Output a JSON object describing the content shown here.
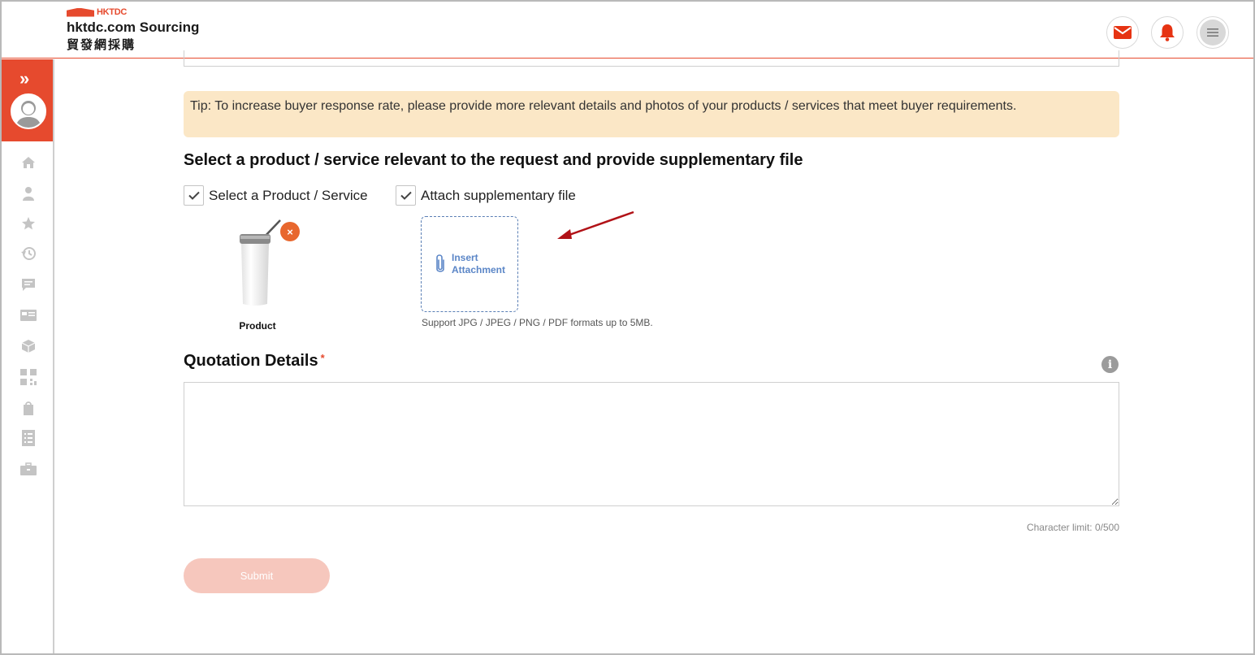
{
  "header": {
    "logo_text": "HKTDC",
    "brand_en": "hktdc.com Sourcing",
    "brand_zh": "貿發網採購",
    "icons": [
      "mail-icon",
      "bell-icon",
      "menu-icon"
    ],
    "accent_color": "#e64a2e"
  },
  "sidebar": {
    "expand_glyph": "»",
    "items": [
      {
        "icon": "home-icon"
      },
      {
        "icon": "user-icon"
      },
      {
        "icon": "star-icon"
      },
      {
        "icon": "history-icon"
      },
      {
        "icon": "message-icon"
      },
      {
        "icon": "card-icon"
      },
      {
        "icon": "box-icon"
      },
      {
        "icon": "qr-icon"
      },
      {
        "icon": "bag-icon"
      },
      {
        "icon": "list-icon"
      },
      {
        "icon": "briefcase-icon"
      }
    ]
  },
  "tip": {
    "text": "Tip: To increase buyer response rate, please provide more relevant details and photos of your products / services that meet buyer requirements."
  },
  "selection": {
    "title": "Select a product / service relevant to the request and provide supplementary file",
    "option_product": "Select a Product / Service",
    "option_attach": "Attach supplementary file",
    "product_label": "Product",
    "remove_glyph": "×",
    "attach_label_line1": "Insert",
    "attach_label_line2": "Attachment",
    "support_note": "Support JPG / JPEG / PNG / PDF formats up to 5MB."
  },
  "quotation": {
    "title": "Quotation Details",
    "required_mark": "*",
    "info_glyph": "i",
    "value": "",
    "char_limit": "Character limit: 0/500"
  },
  "actions": {
    "submit_label": "Submit"
  }
}
